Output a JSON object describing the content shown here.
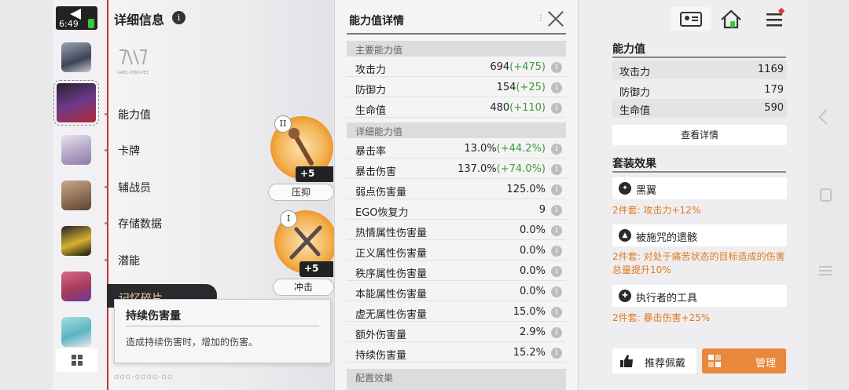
{
  "status": {
    "time": "6:49"
  },
  "left": {
    "title": "详细信息",
    "info_icon": "i",
    "menu": [
      "能力值",
      "卡牌",
      "辅战员",
      "存储数据",
      "潜能"
    ],
    "active_menu": "记忆碎片",
    "logo_caption": "GABC-036X-VE3",
    "fragments": [
      {
        "rank": "II",
        "level": "+5",
        "label": "压抑"
      },
      {
        "rank": "I",
        "level": "+5",
        "label": "冲击"
      }
    ],
    "tooltip": {
      "title": "持续伤害量",
      "desc": "造成持续伤害时，增加的伤害。"
    },
    "bottom_deco": "ɑɑɑ-ɑɑɑɑ-ɑɑ"
  },
  "detail": {
    "title": "能力值详情",
    "main_header": "主要能力值",
    "main_stats": [
      {
        "name": "攻击力",
        "value": "694",
        "bonus": "(+475)"
      },
      {
        "name": "防御力",
        "value": "154",
        "bonus": "(+25)"
      },
      {
        "name": "生命值",
        "value": "480",
        "bonus": "(+110)"
      }
    ],
    "sub_header": "详细能力值",
    "sub_stats": [
      {
        "name": "暴击率",
        "value": "13.0%",
        "bonus": "(+44.2%)"
      },
      {
        "name": "暴击伤害",
        "value": "137.0%",
        "bonus": "(+74.0%)"
      },
      {
        "name": "弱点伤害量",
        "value": "125.0%",
        "bonus": ""
      },
      {
        "name": "EGO恢复力",
        "value": "9",
        "bonus": ""
      },
      {
        "name": "热情属性伤害量",
        "value": "0.0%",
        "bonus": ""
      },
      {
        "name": "正义属性伤害量",
        "value": "0.0%",
        "bonus": ""
      },
      {
        "name": "秩序属性伤害量",
        "value": "0.0%",
        "bonus": ""
      },
      {
        "name": "本能属性伤害量",
        "value": "0.0%",
        "bonus": ""
      },
      {
        "name": "虚无属性伤害量",
        "value": "15.0%",
        "bonus": ""
      },
      {
        "name": "额外伤害量",
        "value": "2.9%",
        "bonus": ""
      },
      {
        "name": "持续伤害量",
        "value": "15.2%",
        "bonus": ""
      }
    ],
    "next_header": "配置效果"
  },
  "right": {
    "stats_title": "能力值",
    "stats": [
      {
        "name": "攻击力",
        "value": "1169"
      },
      {
        "name": "防御力",
        "value": "179"
      },
      {
        "name": "生命值",
        "value": "590"
      }
    ],
    "view_detail": "查看详情",
    "set_title": "套装效果",
    "sets": [
      {
        "name": "黑翼",
        "bonus": "2件套:  攻击力+12%"
      },
      {
        "name": "被施咒的遗骸",
        "bonus": "2件套:  对处于痛苦状态的目标造成的伤害总量提升10%"
      },
      {
        "name": "执行者的工具",
        "bonus": "2件套:  暴击伤害+25%"
      }
    ],
    "recommend": "推荐佩戴",
    "manage": "管理"
  },
  "colors": {
    "accent_orange": "#e9883a",
    "bonus_green": "#3a9c3a",
    "set_orange": "#e07a1e"
  }
}
